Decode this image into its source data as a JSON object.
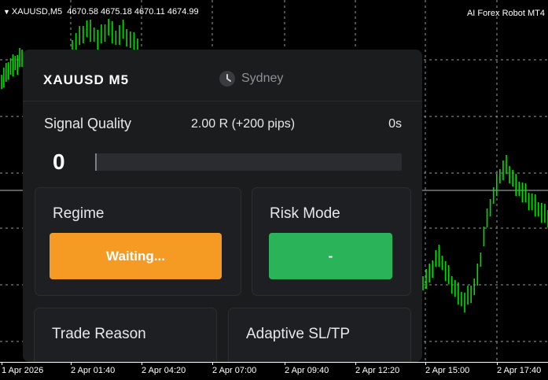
{
  "chart": {
    "symbol_label": "XAUUSD,M5",
    "ohlc": "4670.58 4675.18 4670.11 4674.99",
    "robot_name": "AI Forex Robot MT4",
    "x_labels": [
      "1 Apr 2026",
      "2 Apr 01:40",
      "2 Apr 04:20",
      "2 Apr 07:00",
      "2 Apr 09:40",
      "2 Apr 12:20",
      "2 Apr 15:00",
      "2 Apr 17:40"
    ],
    "background": "#000000",
    "candle_color": "#00e000"
  },
  "panel": {
    "symbol": "XAUUSD M5",
    "session": "Sydney",
    "session_icon": "clock-icon",
    "signal_quality_label": "Signal Quality",
    "signal_quality_value": "2.00 R (+200 pips)",
    "signal_quality_time": "0s",
    "score": "0",
    "score_fraction": 0,
    "cards": {
      "regime": {
        "title": "Regime",
        "value": "Waiting...",
        "color": "#f59a23"
      },
      "risk_mode": {
        "title": "Risk Mode",
        "value": "-",
        "color": "#2bb35a"
      },
      "trade_reason": {
        "title": "Trade Reason"
      },
      "adaptive_sltp": {
        "title": "Adaptive SL/TP"
      }
    }
  }
}
